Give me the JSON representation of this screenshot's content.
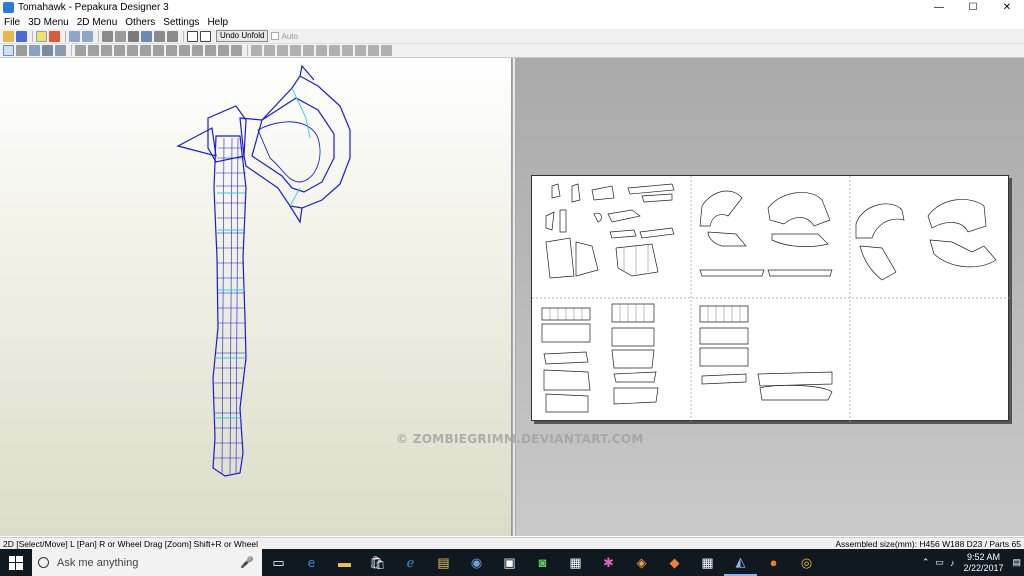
{
  "window": {
    "title": "Tomahawk - Pepakura Designer 3",
    "controls": {
      "minimize": "—",
      "maximize": "☐",
      "close": "✕"
    }
  },
  "menu": [
    "File",
    "3D Menu",
    "2D Menu",
    "Others",
    "Settings",
    "Help"
  ],
  "toolbar": {
    "undo_unfold_label": "Undo Unfold",
    "auto_label": "Auto"
  },
  "watermark": "© ZOMBIEGRIMM.DEVIANTART.COM",
  "statusbar": {
    "left": "2D [Select/Move] L [Pan] R or Wheel Drag [Zoom] Shift+R or Wheel",
    "right": "Assembled size(mm): H456 W188 D23 / Parts 65"
  },
  "taskbar": {
    "search_placeholder": "Ask me anything",
    "time": "9:52 AM",
    "date": "2/22/2017",
    "icons": [
      "task-view-icon",
      "edge-icon",
      "file-explorer-icon",
      "store-icon",
      "ie-icon",
      "files-icon",
      "word-icon",
      "app-icon",
      "green-app-icon",
      "media-icon",
      "paint-icon",
      "blender-icon",
      "art-icon",
      "calculator-icon",
      "pepakura-icon",
      "firefox-icon",
      "chrome-icon"
    ]
  },
  "colors": {
    "mesh": "#1a1adf",
    "mesh_highlight": "#2ad0e8"
  }
}
